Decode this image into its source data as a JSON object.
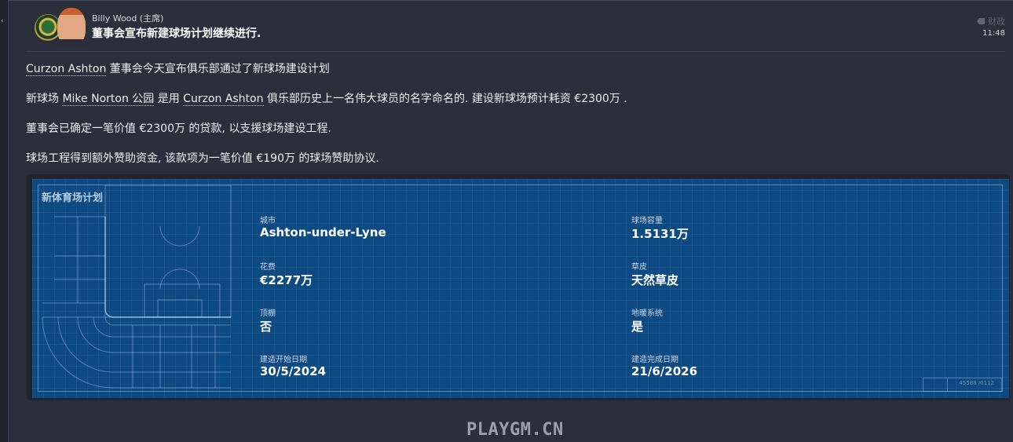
{
  "message": {
    "sender": "Billy Wood (主席)",
    "subject": "董事会宣布新建球场计划继续进行.",
    "category": "财政",
    "time": "11:48"
  },
  "body": {
    "p1_club": "Curzon Ashton",
    "p1_rest": " 董事会今天宣布俱乐部通过了新球场建设计划",
    "p2_a": "新球场 ",
    "p2_stadium": "Mike Norton 公园",
    "p2_b": " 是用 ",
    "p2_club": "Curzon Ashton",
    "p2_c": " 俱乐部历史上一名伟大球员的名字命名的. 建设新球场预计耗资 €2300万 .",
    "p3": "董事会已确定一笔价值 €2300万 的贷款, 以支援球场建设工程.",
    "p4": "球场工程得到额外赞助资金, 该款项为一笔价值 €190万 的球场赞助协议."
  },
  "plan": {
    "title": "新体育场计划",
    "city_label": "城市",
    "city_value": "Ashton-under-Lyne",
    "capacity_label": "球场容量",
    "capacity_value": "1.5131万",
    "cost_label": "花费",
    "cost_value": "€2277万",
    "pitch_label": "草皮",
    "pitch_value": "天然草皮",
    "roof_label": "顶棚",
    "roof_value": "否",
    "heating_label": "地暖系统",
    "heating_value": "是",
    "start_label": "建造开始日期",
    "start_value": "30/5/2024",
    "end_label": "建造完成日期",
    "end_value": "21/6/2026",
    "stamp": "45588 /0112"
  },
  "watermark": "PLAYGM.CN"
}
